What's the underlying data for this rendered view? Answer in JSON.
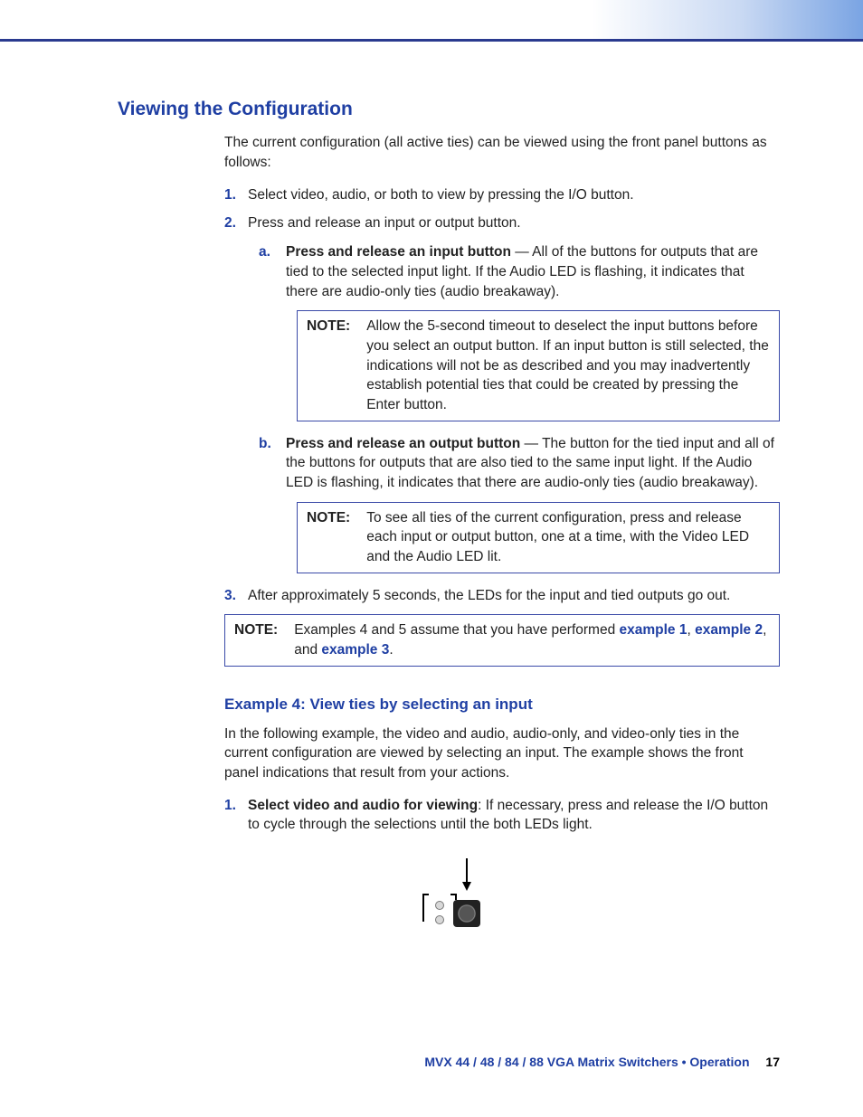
{
  "heading": "Viewing the Configuration",
  "intro": "The current configuration (all active ties) can be viewed using the front panel buttons as follows:",
  "steps": {
    "n1": "1.",
    "t1": "Select video, audio, or both to view by pressing the I/O button.",
    "n2": "2.",
    "t2": "Press and release an input or output button.",
    "a_letter": "a.",
    "a_bold": "Press and release an input button",
    "a_rest": " — All of the buttons for outputs that are tied to the selected input light. If the Audio LED is flashing, it indicates that there are audio-only ties (audio breakaway).",
    "b_letter": "b.",
    "b_bold": "Press and release an output button",
    "b_rest": " — The button for the tied input and all of the buttons for outputs that are also tied to the same input light. If the Audio LED is flashing, it indicates that there are audio-only ties (audio breakaway).",
    "n3": "3.",
    "t3": "After approximately 5 seconds, the LEDs for the input and tied outputs go out."
  },
  "notes": {
    "label": "NOTE:",
    "n1": "Allow the 5-second timeout to deselect the input buttons before you select an output button. If an input button is still selected, the indications will not be as described and you may inadvertently establish potential ties that could be created by pressing the Enter button.",
    "n2": "To see all ties of the current configuration, press and release each input or output button, one at a time, with the Video LED and the Audio LED lit.",
    "n3_pre": "Examples 4 and 5 assume that you have performed ",
    "ex1": "example 1",
    "sep1": ", ",
    "ex2": "example 2",
    "sep2": ", and ",
    "ex3": "example 3",
    "period": "."
  },
  "example4": {
    "title": "Example 4: View ties by selecting an input",
    "intro": "In the following example, the video and audio, audio-only, and video-only ties in the current configuration are viewed by selecting an input. The example shows the front panel indications that result from your actions.",
    "s1n": "1.",
    "s1_bold": "Select video and audio for viewing",
    "s1_rest": ": If necessary, press and release the I/O button to cycle through the selections until the both LEDs light."
  },
  "footer": {
    "title": "MVX 44 / 48 / 84 / 88 VGA Matrix Switchers • Operation",
    "page": "17"
  }
}
